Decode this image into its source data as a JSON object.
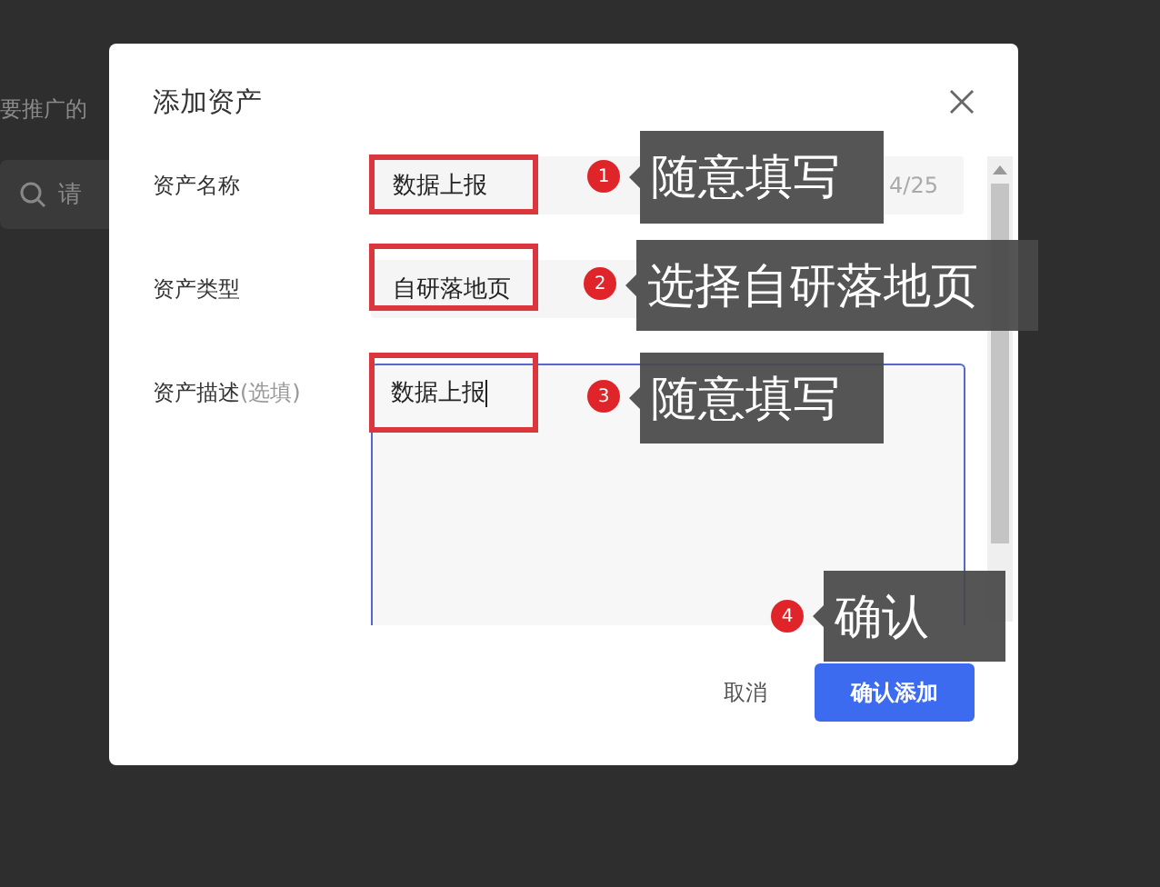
{
  "background": {
    "text": "要推广的",
    "search": {
      "placeholder": "请"
    }
  },
  "dialog": {
    "title": "添加资产",
    "fields": [
      {
        "kind": "text",
        "label": "资产名称",
        "value": "数据上报",
        "counter": "4/25"
      },
      {
        "kind": "select",
        "label": "资产类型",
        "value": "自研落地页"
      },
      {
        "kind": "textarea",
        "label": "资产描述",
        "hint": "(选填)",
        "value": "数据上报",
        "focused": true
      }
    ],
    "buttons": [
      {
        "label": "取消",
        "primary": false
      },
      {
        "label": "确认添加",
        "primary": true
      }
    ]
  },
  "annotations": [
    {
      "number": "1",
      "text": "随意填写"
    },
    {
      "number": "2",
      "text": "选择自研落地页"
    },
    {
      "number": "3",
      "text": "随意填写"
    },
    {
      "number": "4",
      "text": "确认"
    }
  ]
}
